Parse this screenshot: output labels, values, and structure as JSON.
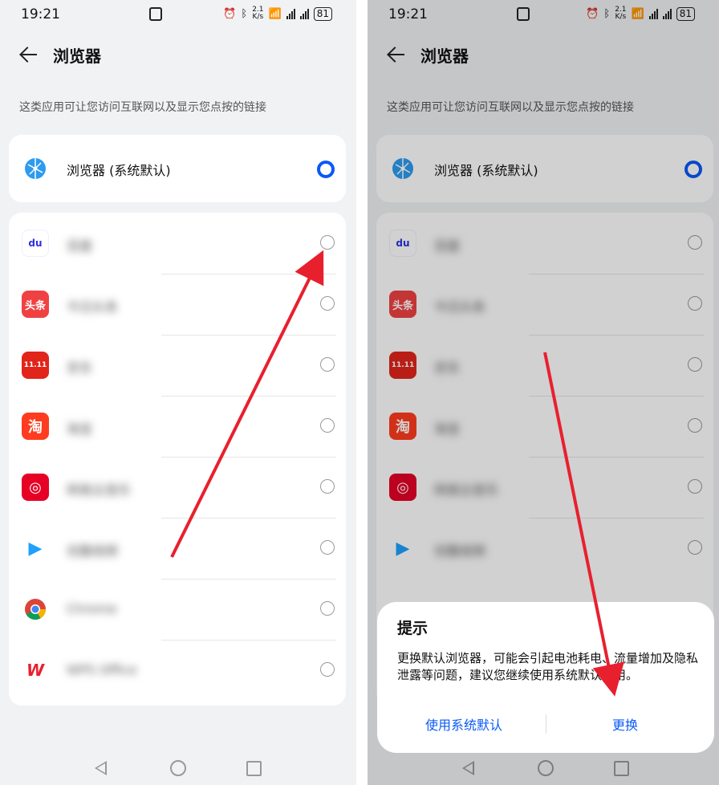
{
  "status": {
    "time": "19:21",
    "net_speed_top": "2.1",
    "net_speed_unit": "K/s",
    "battery": "81"
  },
  "header": {
    "title": "浏览器"
  },
  "description": "这类应用可让您访问互联网以及显示您点按的链接",
  "default_app": {
    "name": "浏览器 (系统默认)",
    "selected": true,
    "icon": "globe-icon"
  },
  "apps": [
    {
      "name": "百度",
      "icon": "baidu-icon",
      "icon_text": "du"
    },
    {
      "name": "今日头条",
      "icon": "toutiao-icon",
      "icon_text": "头条"
    },
    {
      "name": "京东",
      "icon": "jd-icon",
      "icon_text": "11.11"
    },
    {
      "name": "淘宝",
      "icon": "taobao-icon",
      "icon_text": "淘"
    },
    {
      "name": "网易云音乐",
      "icon": "netease-music-icon",
      "icon_text": "◎"
    },
    {
      "name": "优酷视频",
      "icon": "youku-icon",
      "icon_text": "▶"
    },
    {
      "name": "Chrome",
      "icon": "chrome-icon",
      "icon_text": ""
    },
    {
      "name": "WPS Office",
      "icon": "wps-icon",
      "icon_text": "W"
    }
  ],
  "dialog": {
    "title": "提示",
    "message": "更换默认浏览器，可能会引起电池耗电、流量增加及隐私泄露等问题，建议您继续使用系统默认应用。",
    "use_default_label": "使用系统默认",
    "change_label": "更换"
  },
  "colors": {
    "accent": "#0a59f7",
    "arrow": "#e8202e"
  }
}
